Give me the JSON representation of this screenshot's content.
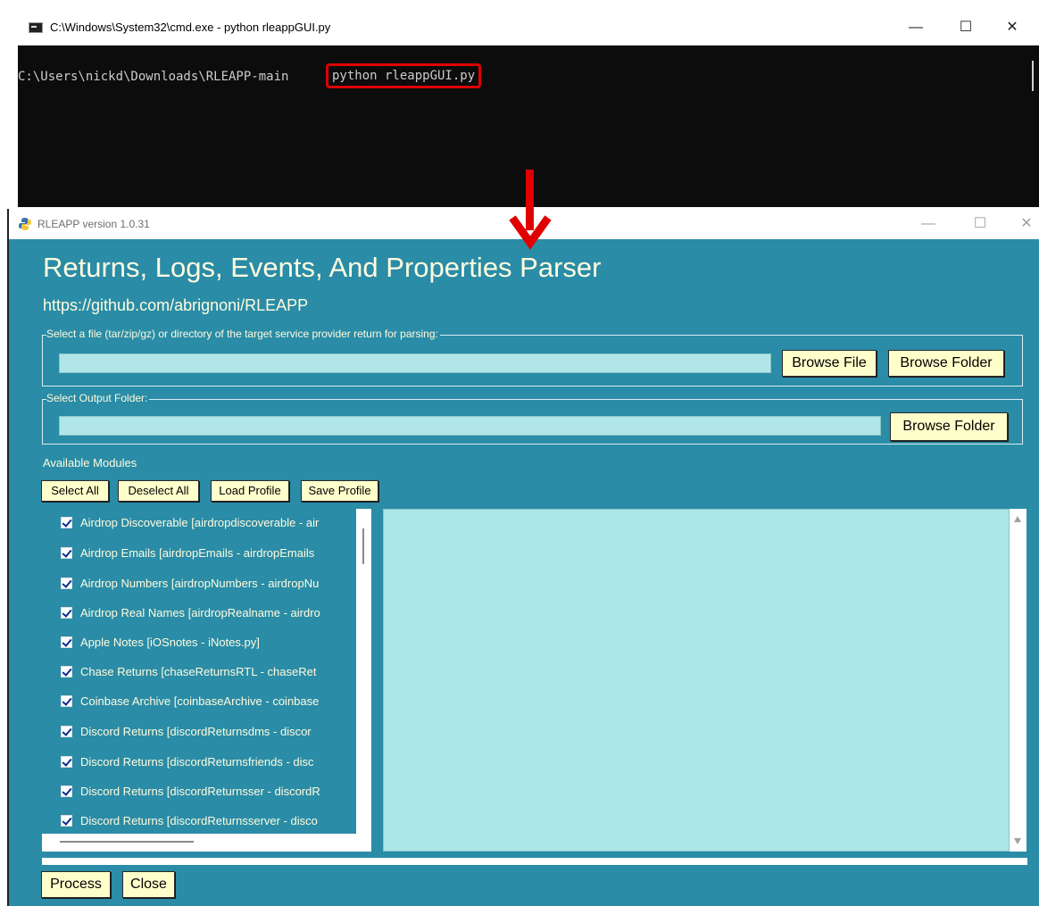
{
  "cmd": {
    "title": "C:\\Windows\\System32\\cmd.exe - python  rleappGUI.py",
    "controls": {
      "minimize": "—",
      "maximize": "☐",
      "close": "✕"
    },
    "prompt": "C:\\Users\\nickd\\Downloads\\RLEAPP-main",
    "command": "python rleappGUI.py"
  },
  "annotation": {
    "arrow_color": "#e00000",
    "highlight_color": "#e00000"
  },
  "rleapp": {
    "title": "RLEAPP version 1.0.31",
    "controls": {
      "minimize": "—",
      "maximize": "☐",
      "close": "✕"
    },
    "heading": "Returns, Logs, Events, And Properties Parser",
    "url": "https://github.com/abrignoni/RLEAPP",
    "input_group": {
      "label": "Select a file (tar/zip/gz) or directory of the target service provider return for parsing:",
      "value": "",
      "browse_file": "Browse File",
      "browse_folder": "Browse Folder"
    },
    "output_group": {
      "label": "Select Output Folder:",
      "value": "",
      "browse_folder": "Browse Folder"
    },
    "modules": {
      "label": "Available Modules",
      "buttons": {
        "select_all": "Select All",
        "deselect_all": "Deselect All",
        "load_profile": "Load Profile",
        "save_profile": "Save Profile"
      },
      "items": [
        {
          "label": "Airdrop Discoverable [airdropdiscoverable - air",
          "checked": true
        },
        {
          "label": "Airdrop Emails [airdropEmails - airdropEmails",
          "checked": true
        },
        {
          "label": "Airdrop Numbers [airdropNumbers - airdropNu",
          "checked": true
        },
        {
          "label": "Airdrop Real Names [airdropRealname - airdro",
          "checked": true
        },
        {
          "label": "Apple Notes [iOSnotes - iNotes.py]",
          "checked": true
        },
        {
          "label": "Chase Returns [chaseReturnsRTL - chaseRet",
          "checked": true
        },
        {
          "label": "Coinbase Archive [coinbaseArchive - coinbase",
          "checked": true
        },
        {
          "label": "Discord Returns [discordReturnsdms - discor",
          "checked": true
        },
        {
          "label": "Discord Returns [discordReturnsfriends - disc",
          "checked": true
        },
        {
          "label": "Discord Returns [discordReturnsser - discordR",
          "checked": true
        },
        {
          "label": "Discord Returns [discordReturnsserver - disco",
          "checked": true
        }
      ]
    },
    "log": {
      "text": ""
    },
    "progress": 0,
    "actions": {
      "process": "Process",
      "close": "Close"
    },
    "colors": {
      "background": "#2a8ca6",
      "button": "#ffffcc",
      "entry": "#b0e6e8",
      "text": "#fffbe0"
    }
  }
}
